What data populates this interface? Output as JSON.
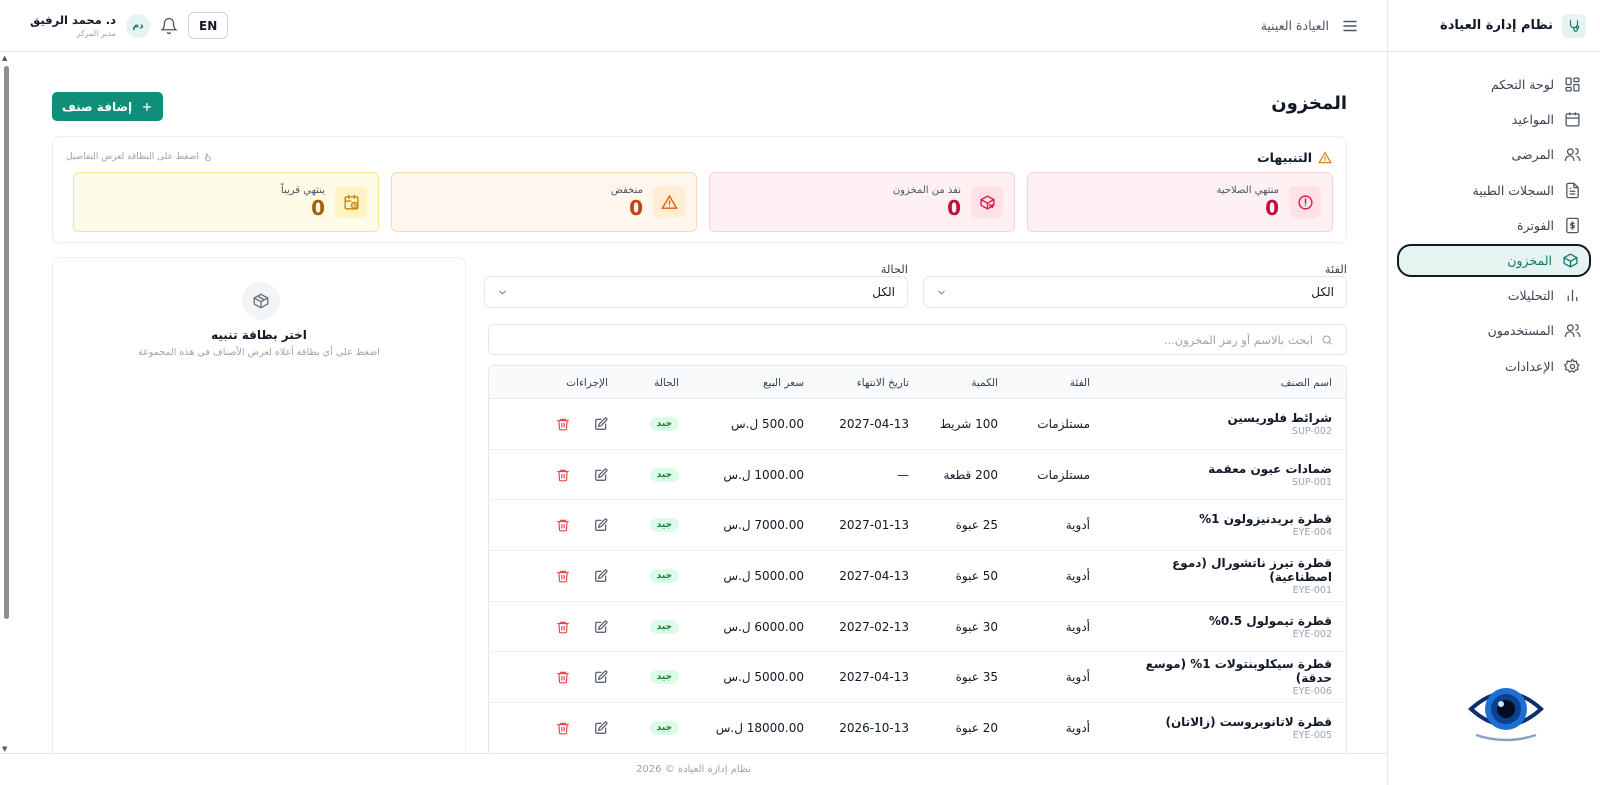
{
  "app": {
    "title": "نظام إدارة العيادة",
    "clinic_name": "العيادة العينية"
  },
  "sidebar": {
    "items": [
      {
        "label": "لوحة التحكم",
        "icon": "dashboard-icon"
      },
      {
        "label": "المواعيد",
        "icon": "calendar-icon"
      },
      {
        "label": "المرضى",
        "icon": "users-icon"
      },
      {
        "label": "السجلات الطبية",
        "icon": "file-icon"
      },
      {
        "label": "الفوترة",
        "icon": "dollar-icon"
      },
      {
        "label": "المخزون",
        "icon": "package-icon",
        "active": true
      },
      {
        "label": "التحليلات",
        "icon": "chart-icon"
      },
      {
        "label": "المستخدمون",
        "icon": "users-icon"
      },
      {
        "label": "الإعدادات",
        "icon": "gear-icon"
      }
    ]
  },
  "header": {
    "lang_label": "EN",
    "user": {
      "initials": "دم",
      "name": "د. محمد الرفيق",
      "role": "مدير المركز"
    }
  },
  "page": {
    "title": "المخزون",
    "add_label": "إضافة صنف"
  },
  "alerts": {
    "title": "التنبيهات",
    "hint": "اضغط على البطاقة لعرض التفاصيل",
    "cards": [
      {
        "label": "منتهي الصلاحية",
        "count": "0",
        "icon": "alert-circle-icon"
      },
      {
        "label": "نفذ من المخزون",
        "count": "0",
        "icon": "package-x-icon"
      },
      {
        "label": "منخفض",
        "count": "0",
        "icon": "warning-icon"
      },
      {
        "label": "ينتهي قريباً",
        "count": "0",
        "icon": "calendar-clock-icon"
      }
    ]
  },
  "filters": {
    "category_label": "الفئة",
    "category_value": "الكل",
    "status_label": "الحالة",
    "status_value": "الكل",
    "search_placeholder": "ابحث بالاسم أو رمز المخزون..."
  },
  "table": {
    "headers": {
      "name": "اسم الصنف",
      "category": "الفئة",
      "quantity": "الكمية",
      "expiry": "تاريخ الانتهاء",
      "price": "سعر البيع",
      "status": "الحالة",
      "actions": "الإجراءات"
    },
    "rows": [
      {
        "name": "شرائط فلوريسين",
        "code": "SUP-002",
        "category": "مستلزمات",
        "quantity": "100 شريط",
        "expiry": "2027-04-13",
        "price": "500.00 ل.س",
        "status": "جيد"
      },
      {
        "name": "ضمادات عيون معقمة",
        "code": "SUP-001",
        "category": "مستلزمات",
        "quantity": "200 قطعة",
        "expiry": "—",
        "price": "1000.00 ل.س",
        "status": "جيد"
      },
      {
        "name": "قطرة بريدنيزولون 1%",
        "code": "EYE-004",
        "category": "أدوية",
        "quantity": "25 عبوة",
        "expiry": "2027-01-13",
        "price": "7000.00 ل.س",
        "status": "جيد"
      },
      {
        "name": "قطرة تيرز ناتشورال (دموع اصطناعية)",
        "code": "EYE-001",
        "category": "أدوية",
        "quantity": "50 عبوة",
        "expiry": "2027-04-13",
        "price": "5000.00 ل.س",
        "status": "جيد"
      },
      {
        "name": "قطرة تيمولول 0.5%",
        "code": "EYE-002",
        "category": "أدوية",
        "quantity": "30 عبوة",
        "expiry": "2027-02-13",
        "price": "6000.00 ل.س",
        "status": "جيد"
      },
      {
        "name": "قطرة سيكلوبنتولات 1% (موسع حدقة)",
        "code": "EYE-006",
        "category": "أدوية",
        "quantity": "35 عبوة",
        "expiry": "2027-04-13",
        "price": "5000.00 ل.س",
        "status": "جيد"
      },
      {
        "name": "قطرة لاتانوبروست (زالاتان)",
        "code": "EYE-005",
        "category": "أدوية",
        "quantity": "20 عبوة",
        "expiry": "2026-10-13",
        "price": "18000.00 ل.س",
        "status": "جيد"
      }
    ]
  },
  "side_panel": {
    "title": "اختر بطاقة تنبيه",
    "subtitle": "اضغط على أي بطاقة أعلاه لعرض الأصناف في هذه المجموعة"
  },
  "footer": {
    "text": "نظام إدارة العيادة © 2026"
  },
  "colors": {
    "primary": "#0f8f7a",
    "danger": "#e11d48",
    "warning": "#ea580c",
    "caution": "#ca8a04",
    "success": "#15803d"
  }
}
